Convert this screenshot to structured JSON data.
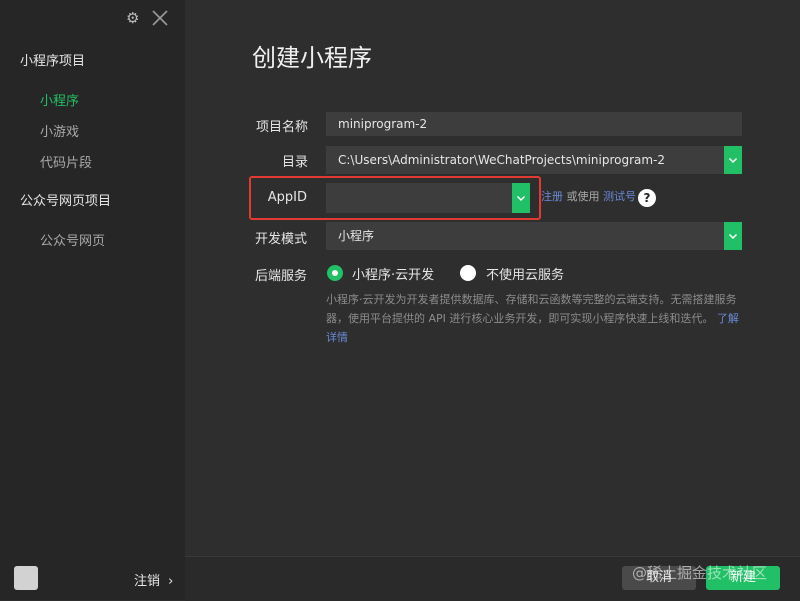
{
  "sidebar": {
    "sections": [
      {
        "title": "小程序项目",
        "items": [
          "小程序",
          "小游戏",
          "代码片段"
        ]
      },
      {
        "title": "公众号网页项目",
        "items": [
          "公众号网页"
        ]
      }
    ],
    "active_item": "小程序",
    "logout_label": "注销",
    "logout_arrow": "›"
  },
  "main": {
    "title": "创建小程序",
    "form": {
      "project_name_label": "项目名称",
      "project_name_value": "miniprogram-2",
      "directory_label": "目录",
      "directory_value": "C:\\Users\\Administrator\\WeChatProjects\\miniprogram-2",
      "appid_label": "AppID",
      "appid_value": "",
      "appid_hint_register": "注册",
      "appid_hint_or": "或使用",
      "appid_hint_test": "测试号",
      "help_label": "?",
      "dev_mode_label": "开发模式",
      "dev_mode_value": "小程序",
      "backend_label": "后端服务",
      "backend_options": [
        "小程序·云开发",
        "不使用云服务"
      ],
      "backend_selected": "小程序·云开发",
      "backend_desc": "小程序·云开发为开发者提供数据库、存储和云函数等完整的云端支持。无需搭建服务器，使用平台提供的 API 进行核心业务开发，即可实现小程序快速上线和迭代。",
      "learn_more": "了解详情"
    }
  },
  "footer": {
    "cancel_label": "取消",
    "create_label": "新建"
  },
  "watermark": "@稀土掘金技术社区",
  "colors": {
    "accent": "#21c066",
    "highlight": "#e03a32",
    "link": "#6a8ad8",
    "sidebar_bg": "#262626",
    "content_bg": "#2e2e2e"
  },
  "icons": [
    "gear-icon",
    "close-icon",
    "chevron-down-icon",
    "help-icon",
    "avatar"
  ]
}
